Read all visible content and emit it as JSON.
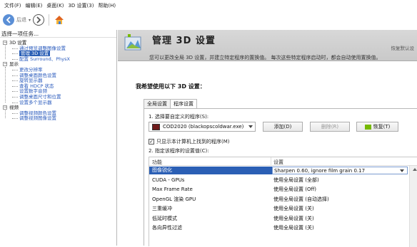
{
  "menu": [
    "文件(F)",
    "编辑(E)",
    "桌面(K)",
    "3D 设置(3)",
    "帮助(H)"
  ],
  "toolbar": {
    "back_label": "后退"
  },
  "left": {
    "title": "选择一项任务...",
    "tree": [
      {
        "label": "3D 设置",
        "level": 0,
        "type": "group"
      },
      {
        "label": "通过预览调整图像设置",
        "level": 1,
        "type": "link"
      },
      {
        "label": "管理 3D 设置",
        "level": 1,
        "type": "selected"
      },
      {
        "label": "配置 Surround、PhysX",
        "level": 1,
        "type": "link"
      },
      {
        "label": "显示",
        "level": 0,
        "type": "group"
      },
      {
        "label": "更改分辨率",
        "level": 1,
        "type": "link"
      },
      {
        "label": "调整桌面颜色设置",
        "level": 1,
        "type": "link"
      },
      {
        "label": "旋转显示器",
        "level": 1,
        "type": "link"
      },
      {
        "label": "查看 HDCP 状态",
        "level": 1,
        "type": "link"
      },
      {
        "label": "设置数字音频",
        "level": 1,
        "type": "link"
      },
      {
        "label": "调整桌面尺寸和位置",
        "level": 1,
        "type": "link"
      },
      {
        "label": "设置多个显示器",
        "level": 1,
        "type": "link"
      },
      {
        "label": "视频",
        "level": 0,
        "type": "group"
      },
      {
        "label": "调整视频颜色设置",
        "level": 1,
        "type": "link"
      },
      {
        "label": "调整视频图像设置",
        "level": 1,
        "type": "link"
      }
    ]
  },
  "main": {
    "title": "管理 3D 设置",
    "restore_link": "恢复默认设",
    "description": "您可以更改全局 3D 设置，并建立特定程序的置换值。 每次这些特定程序启动时，都会自动使用置换值。",
    "section_heading": "我希望使用以下 3D 设置：",
    "tabs": [
      "全局设置",
      "程序设置"
    ],
    "active_tab": "程序设置",
    "step1_label": "1. 选择要自定义的程序(S):",
    "program_selected": "COD2020 (blackopscoldwar.exe)",
    "add_button": "添加(D)",
    "remove_button": "删除(R)",
    "restore_button": "恢复(T)",
    "checkbox_label": "只显示本计算机上找到的程序(M)",
    "checkbox_checked": true,
    "step2_label": "2. 指定该程序的设置值(C):",
    "grid_headers": [
      "功能",
      "设置"
    ],
    "rows": [
      {
        "feature": "图像锐化",
        "value": "Sharpen 0.60, ignore film grain 0.17",
        "selected": true
      },
      {
        "feature": "CUDA - GPUs",
        "value": "使用全局设置 (全部)"
      },
      {
        "feature": "Max Frame Rate",
        "value": "使用全局设置 (Off)"
      },
      {
        "feature": "OpenGL 渲染 GPU",
        "value": "使用全局设置 (自动选择)"
      },
      {
        "feature": "三重缓冲",
        "value": "使用全局设置 (关)"
      },
      {
        "feature": "低延时模式",
        "value": "使用全局设置 (关)"
      },
      {
        "feature": "各向异性过滤",
        "value": "使用全局设置 (关)"
      }
    ]
  },
  "colors": {
    "selection": "#2b5fb5",
    "link": "#2a5bbd",
    "nvidia_green": "#76b900"
  }
}
